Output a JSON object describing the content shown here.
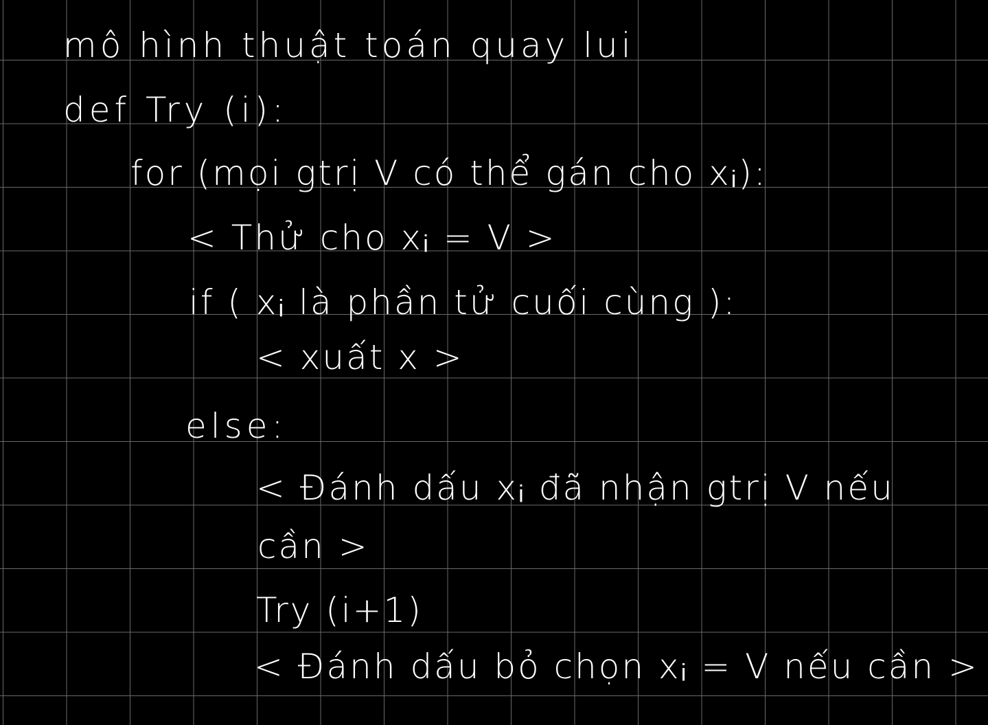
{
  "lines": [
    "mô hình thuật toán quay lui",
    "def Try (i):",
    "for (mọi gtrị V có thể gán cho xᵢ):",
    "< Thử cho xᵢ = V >",
    "if ( xᵢ là phần tử cuối cùng ):",
    "< xuất x >",
    "else:",
    "< Đánh dấu xᵢ đã nhận gtrị V nếu",
    "cần >",
    "Try (i+1)",
    "< Đánh dấu bỏ chọn xᵢ = V nếu cần >"
  ],
  "colors": {
    "background": "#000000",
    "grid": "#6a6a6a",
    "ink": "#ffffff"
  }
}
